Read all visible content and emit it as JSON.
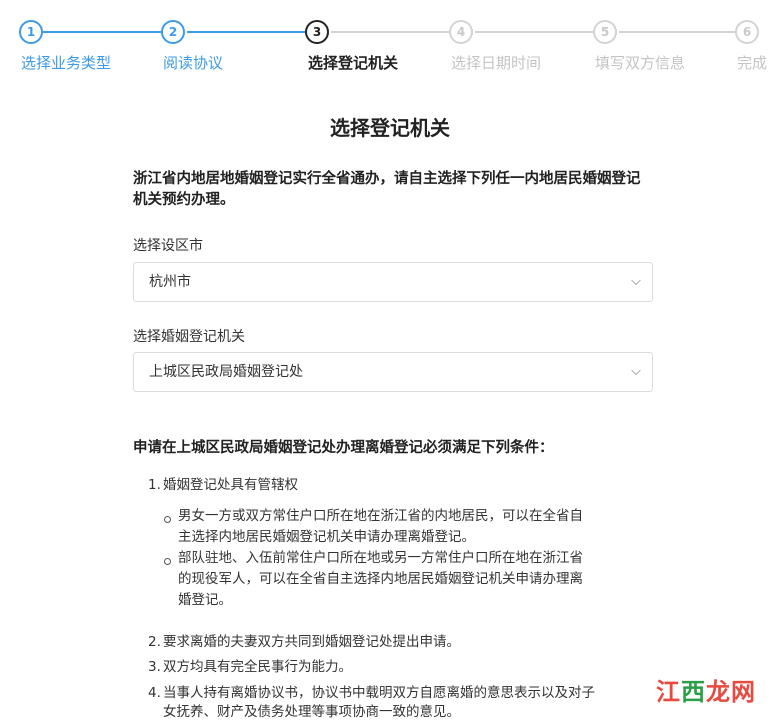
{
  "colors": {
    "accent": "#3d9ae8",
    "inactive": "#c4c4c4",
    "text": "#222222"
  },
  "stepper": {
    "steps": [
      {
        "num": "1",
        "label": "选择业务类型",
        "state": "done"
      },
      {
        "num": "2",
        "label": "阅读协议",
        "state": "done"
      },
      {
        "num": "3",
        "label": "选择登记机关",
        "state": "active"
      },
      {
        "num": "4",
        "label": "选择日期时间",
        "state": "todo"
      },
      {
        "num": "5",
        "label": "填写双方信息",
        "state": "todo"
      },
      {
        "num": "6",
        "label": "完成",
        "state": "todo"
      }
    ]
  },
  "page": {
    "title": "选择登记机关",
    "notice": "浙江省内地居地婚姻登记实行全省通办，请自主选择下列任一内地居民婚姻登记机关预约办理。"
  },
  "form": {
    "city_label": "选择设区市",
    "city_value": "杭州市",
    "office_label": "选择婚姻登记机关",
    "office_value": "上城区民政局婚姻登记处"
  },
  "conditions": {
    "title": "申请在上城区民政局婚姻登记处办理离婚登记必须满足下列条件：",
    "items": [
      {
        "num": "1.",
        "text": "婚姻登记处具有管辖权"
      },
      {
        "num": "2.",
        "text": "要求离婚的夫妻双方共同到婚姻登记处提出申请。"
      },
      {
        "num": "3.",
        "text": "双方均具有完全民事行为能力。"
      },
      {
        "num": "4.",
        "text": "当事人持有离婚协议书，协议书中载明双方自愿离婚的意思表示以及对子"
      },
      {
        "num": "",
        "text": "女抚养、财产及债务处理等事项协商一致的意见。"
      }
    ],
    "sub_items": [
      {
        "lines": [
          "男女一方或双方常住户口所在地在浙江省的内地居民，可以在全省自",
          "主选择内地居民婚姻登记机关申请办理离婚登记。"
        ]
      },
      {
        "lines": [
          "部队驻地、入伍前常住户口所在地或另一方常住户口所在地在浙江省",
          "的现役军人，可以在全省自主选择内地居民婚姻登记机关申请办理离",
          "婚登记。"
        ]
      }
    ]
  },
  "watermark": {
    "part1": "江",
    "part2": "西",
    "part3": "龙网"
  }
}
